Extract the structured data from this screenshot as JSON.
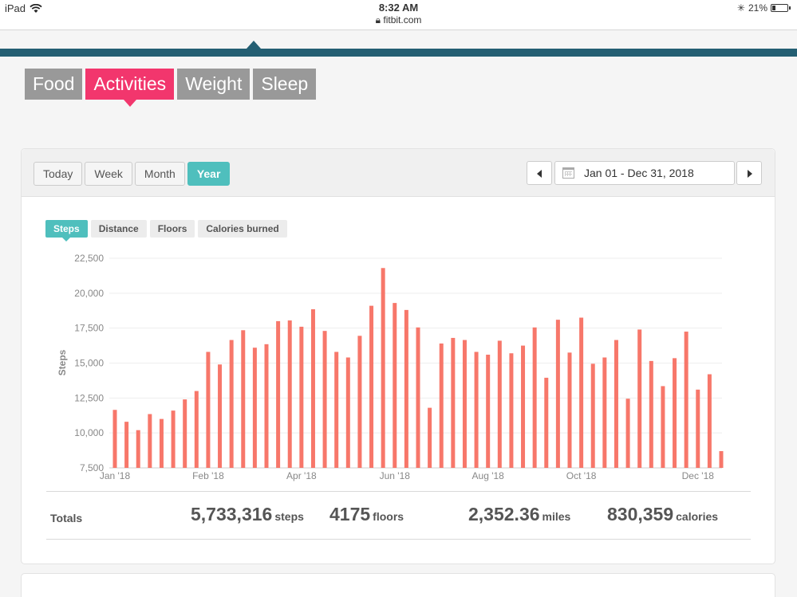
{
  "status_bar": {
    "device": "iPad",
    "time": "8:32 AM",
    "url": "fitbit.com",
    "battery": "21%"
  },
  "category_tabs": [
    {
      "label": "Food",
      "active": false
    },
    {
      "label": "Activities",
      "active": true
    },
    {
      "label": "Weight",
      "active": false
    },
    {
      "label": "Sleep",
      "active": false
    }
  ],
  "range_tabs": [
    {
      "label": "Today",
      "active": false
    },
    {
      "label": "Week",
      "active": false
    },
    {
      "label": "Month",
      "active": false
    },
    {
      "label": "Year",
      "active": true
    }
  ],
  "date_range": "Jan 01 - Dec 31, 2018",
  "metric_tabs": [
    {
      "label": "Steps",
      "active": true
    },
    {
      "label": "Distance",
      "active": false
    },
    {
      "label": "Floors",
      "active": false
    },
    {
      "label": "Calories burned",
      "active": false
    }
  ],
  "colors": {
    "accent_pink": "#f2366d",
    "accent_teal": "#4fbfbd",
    "band": "#245f73",
    "bar": "#f7776a"
  },
  "chart_data": {
    "type": "bar",
    "ylabel": "Steps",
    "ylim": [
      7500,
      22500
    ],
    "yticks": [
      "22,500",
      "20,000",
      "17,500",
      "15,000",
      "12,500",
      "10,000",
      "7,500"
    ],
    "xticks": [
      {
        "label": "Jan '18",
        "index": 0
      },
      {
        "label": "Feb '18",
        "index": 8
      },
      {
        "label": "Apr '18",
        "index": 16
      },
      {
        "label": "Jun '18",
        "index": 24
      },
      {
        "label": "Aug '18",
        "index": 32
      },
      {
        "label": "Oct '18",
        "index": 40
      },
      {
        "label": "Dec '18",
        "index": 50
      }
    ],
    "grid": true,
    "values": [
      11650,
      10800,
      10200,
      11350,
      11000,
      11600,
      12400,
      13000,
      15800,
      14900,
      16650,
      17350,
      16100,
      16350,
      18000,
      18050,
      17600,
      18850,
      17300,
      15800,
      15400,
      16950,
      19100,
      21800,
      19300,
      18800,
      17550,
      11800,
      16400,
      16800,
      16650,
      15800,
      15600,
      16600,
      15700,
      16250,
      17550,
      13950,
      18100,
      15750,
      18250,
      14950,
      15400,
      16650,
      12450,
      17400,
      15150,
      13350,
      15350,
      17250,
      13100,
      14200,
      8700
    ]
  },
  "totals": {
    "label": "Totals",
    "steps": {
      "value": "5,733,316",
      "unit": "steps"
    },
    "floors": {
      "value": "4175",
      "unit": "floors"
    },
    "miles": {
      "value": "2,352.36",
      "unit": "miles"
    },
    "calories": {
      "value": "830,359",
      "unit": "calories"
    }
  }
}
